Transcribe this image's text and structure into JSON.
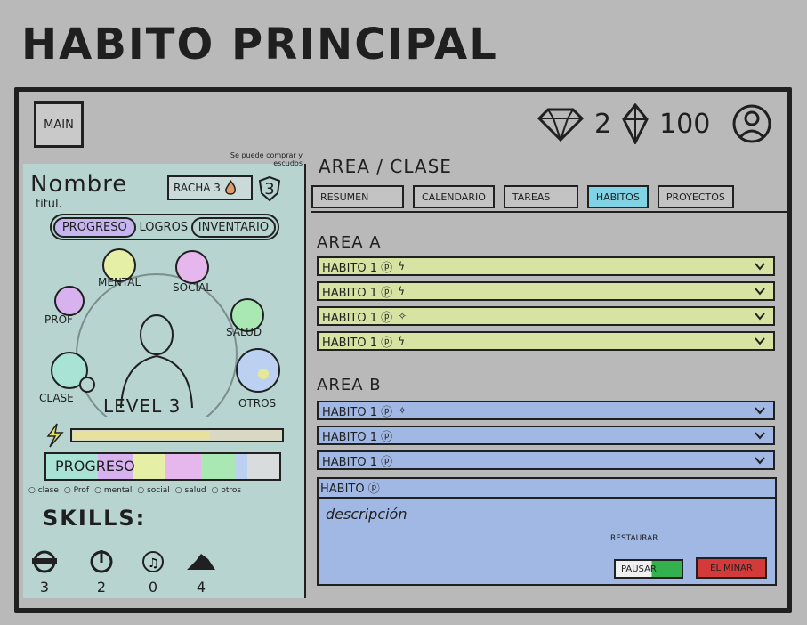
{
  "page_title": "HABITO PRINCIPAL",
  "topbar": {
    "main_label": "MAIN",
    "gems": "2",
    "crystals": "100"
  },
  "character": {
    "name": "Nombre",
    "title": "titul.",
    "streak_label": "RACHA 3",
    "streak_count": "3",
    "streak_note": "Se puede comprar y escudos",
    "tabs": [
      "PROGRESO",
      "LOGROS",
      "INVENTARIO"
    ],
    "stats": [
      "MENTAL",
      "SOCIAL",
      "PROF",
      "SALUD",
      "CLASE",
      "OTROS"
    ],
    "level": "LEVEL 3",
    "progress_label": "PROGRESO",
    "legend": [
      "clase",
      "Prof",
      "mental",
      "social",
      "salud",
      "otros"
    ],
    "skills_label": "SKILLS:",
    "skills": [
      {
        "icon": "mask-icon",
        "value": "3"
      },
      {
        "icon": "compass-icon",
        "value": "2"
      },
      {
        "icon": "music-icon",
        "value": "0"
      },
      {
        "icon": "hat-icon",
        "value": "4"
      }
    ]
  },
  "main": {
    "breadcrumb": "AREA / CLASE",
    "tabs": [
      "RESUMEN",
      "CALENDARIO",
      "TAREAS",
      "HABITOS",
      "PROYECTOS"
    ],
    "active_tab": "HABITOS",
    "area_a": {
      "label": "AREA A",
      "habits": [
        {
          "name": "HABITO 1 ⓟ",
          "icon": "ϟ"
        },
        {
          "name": "HABITO 1 ⓟ",
          "icon": "ϟ"
        },
        {
          "name": "HABITO 1 ⓟ",
          "icon": "✧"
        },
        {
          "name": "HABITO 1 ⓟ",
          "icon": "ϟ"
        }
      ]
    },
    "area_b": {
      "label": "AREA B",
      "habits": [
        {
          "name": "HABITO 1 ⓟ",
          "icon": "✧"
        },
        {
          "name": "HABITO 1 ⓟ",
          "icon": ""
        },
        {
          "name": "HABITO 1 ⓟ",
          "icon": ""
        }
      ]
    },
    "detail": {
      "name": "HABITO ⓟ",
      "description": "descripción",
      "restore_label": "RESTAURAR",
      "pause_label": "PAUSAR",
      "delete_label": "ELIMINAR"
    }
  },
  "colors": {
    "panel": "#b7d4d1",
    "area_a": "#d6e3a3",
    "area_b": "#a1b8e4",
    "active_tab": "#7fd3e4",
    "delete": "#d43a3a",
    "pause": "#33b14f"
  }
}
